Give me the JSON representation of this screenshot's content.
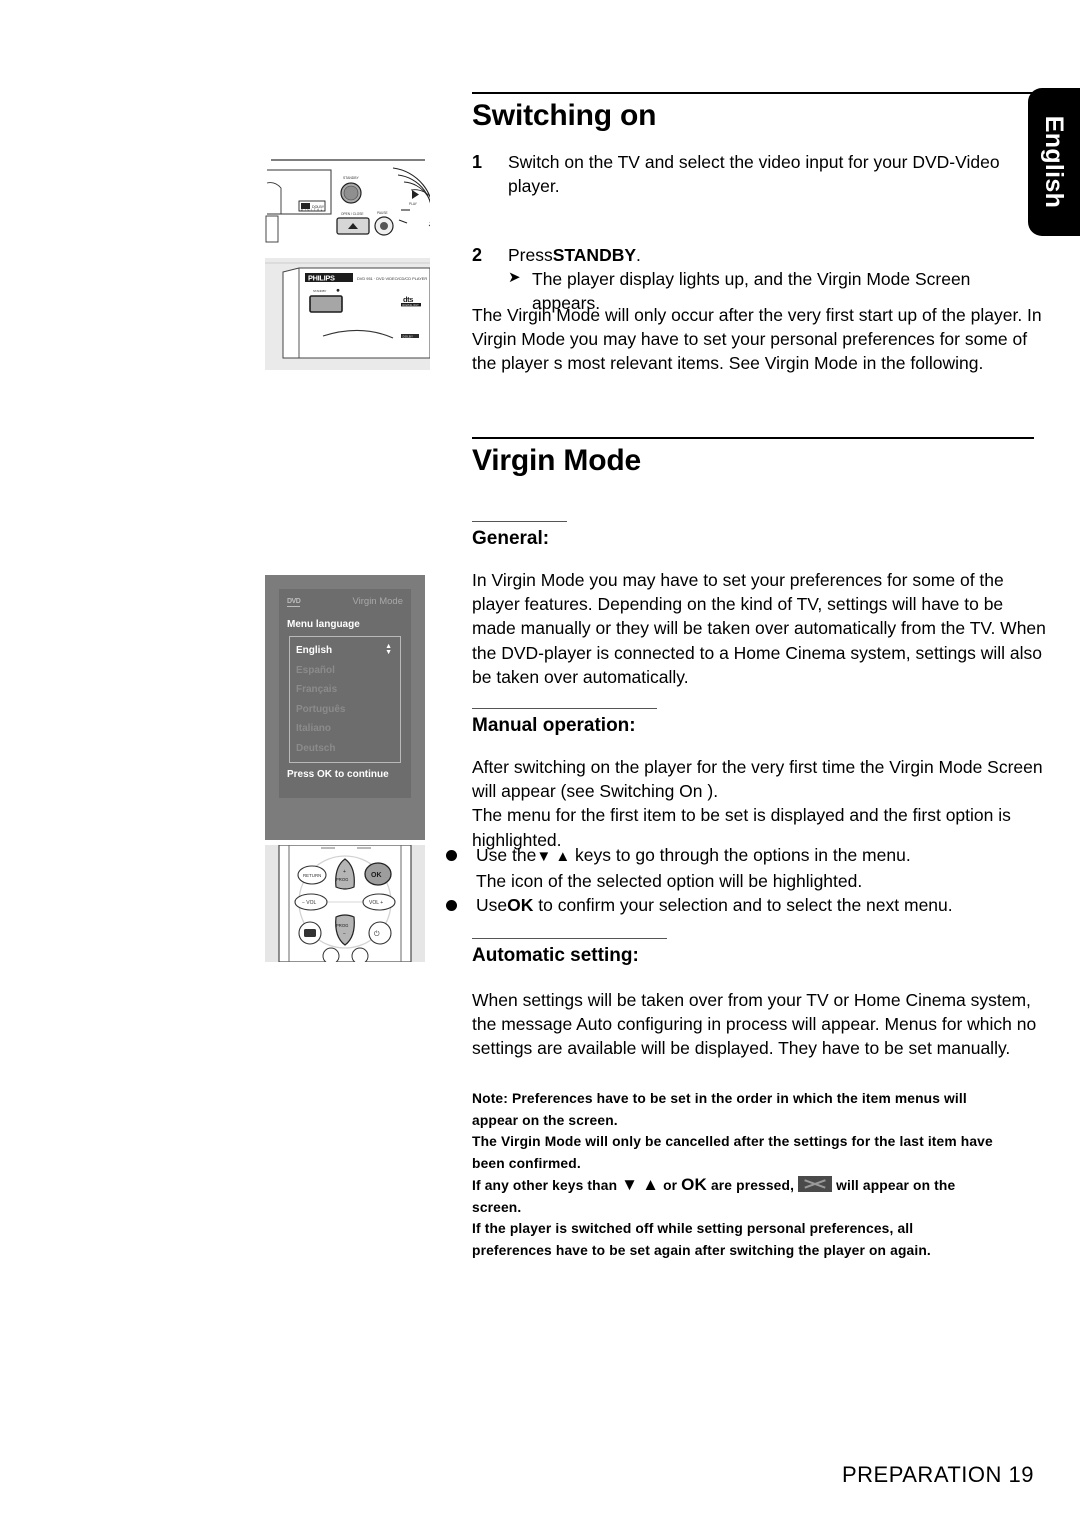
{
  "page": {
    "language_tab": "English",
    "footer": "PREPARATION  19"
  },
  "sections": [
    {
      "id": "switching-on",
      "heading": "Switching on",
      "steps": [
        {
          "number": "1",
          "text": "Switch on the TV and select the video input for your DVD-Video player."
        },
        {
          "number": "2",
          "text": "Press",
          "bold": "STANDBY",
          "text_after": ".",
          "result": "The player display lights up, and the  Virgin Mode Screen  appears."
        }
      ],
      "paragraph": "The  Virgin Mode  will only occur after the very first start up of the player. In  Virgin Mode  you may have to set your personal preferences for some of the player s most relevant items. See  Virgin Mode  in the following."
    },
    {
      "id": "virgin-mode",
      "heading": "Virgin Mode",
      "subsections": [
        {
          "title": "General:",
          "paragraph": "In  Virgin Mode  you may have to set your preferences for some of the player features. Depending on the kind of TV, settings will have to be made manually or they will be taken over automatically from the TV. When the DVD-player is connected to a Home Cinema system, settings will also be taken over automatically."
        },
        {
          "title": "Manual operation:",
          "paragraph1": "After switching on the player for the very first time the  Virgin Mode Screen  will appear (see  Switching On ).",
          "paragraph2": "The menu for the first item to be set is displayed and the first option is highlighted.",
          "bullets": [
            {
              "text_before": "Use the",
              "glyph": "▼ ▲",
              "text_after": " keys to go through the options in the menu.",
              "sub": "The icon of the selected option will be highlighted."
            },
            {
              "text_before": "Use",
              "bold": "OK",
              "text_after": " to confirm your selection and to select the next menu."
            }
          ]
        },
        {
          "title": "Automatic setting:",
          "paragraph": "When settings will be taken over from your TV or Home Cinema system, the message  Auto configuring in process  will appear. Menus for which no settings are available will be displayed. They have to be set manually."
        }
      ],
      "notes": [
        {
          "lead": "Note:",
          "text": " Preferences have to be set in the order in which the item menus will appear on the screen."
        },
        {
          "text": "The  Virgin Mode will only be cancelled after the settings for the last item have been confirmed."
        },
        {
          "part1": "If any other keys than ",
          "glyph1": "▼",
          "glyph2": "▲",
          "mid": " or ",
          "glyph3": "OK",
          "part2": " are pressed,",
          "part3": "will appear on the screen."
        },
        {
          "text": "If the player is switched off while setting personal preferences, all preferences have to be set again after switching the player on again."
        }
      ]
    }
  ],
  "illustrations": {
    "front_panel": {
      "caption": "dvd-player-front-panel-controls",
      "labels": [
        "STANDBY",
        "OPEN/CLOSE",
        "PLAY",
        "DOLBY DIGITAL"
      ]
    },
    "philips_panel": {
      "brand": "PHILIPS",
      "model": "DVD 951 - DVD VIDEO / CD / CD PLAYER",
      "standby_label": "STANDBY",
      "logo_dts": "dts",
      "logo_dd": "DIGITAL"
    },
    "virgin_mode_screen": {
      "logo": "DVD",
      "title": "Virgin Mode",
      "menu_label": "Menu language",
      "options": [
        {
          "label": "English",
          "selected": true
        },
        {
          "label": "Español",
          "selected": false
        },
        {
          "label": "Français",
          "selected": false
        },
        {
          "label": "Português",
          "selected": false
        },
        {
          "label": "Italiano",
          "selected": false
        },
        {
          "label": "Deutsch",
          "selected": false
        }
      ],
      "footer": "Press OK to continue"
    },
    "remote": {
      "buttons": [
        "RETURN",
        "OK",
        "+ PROG",
        "PROG −",
        "− VOL",
        "VOL +"
      ]
    }
  }
}
